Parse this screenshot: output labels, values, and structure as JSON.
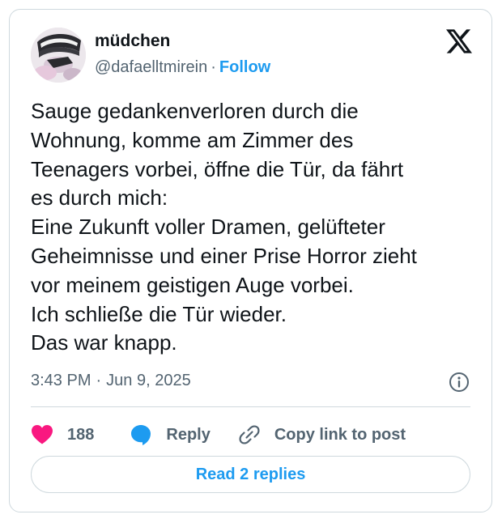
{
  "author": {
    "display_name": "müdchen",
    "handle": "@dafaelltmirein",
    "separator": "·",
    "follow_label": "Follow"
  },
  "tweet": {
    "lines": [
      "Sauge gedankenverloren durch die",
      "Wohnung, komme am Zimmer des",
      "Teenagers vorbei, öffne die Tür, da fährt",
      "es durch mich:",
      "Eine Zukunft voller Dramen, gelüfteter",
      "Geheimnisse und einer Prise Horror zieht",
      "vor meinem geistigen Auge vorbei.",
      "Ich schließe die Tür wieder.",
      "Das war knapp."
    ],
    "time": "3:43 PM",
    "date_separator": "·",
    "date": "Jun 9, 2025"
  },
  "actions": {
    "like_count": "188",
    "reply_label": "Reply",
    "copy_link_label": "Copy link to post"
  },
  "read_replies_label": "Read 2 replies",
  "icons": {
    "brand_logo": "x-logo-icon",
    "info": "info-icon",
    "like": "heart-icon",
    "reply": "speech-bubble-icon",
    "copy_link": "link-icon"
  },
  "colors": {
    "accent": "#1d9bf0",
    "like": "#f91880",
    "text_primary": "#0f1419",
    "text_secondary": "#536471",
    "border": "#cfd9de"
  }
}
